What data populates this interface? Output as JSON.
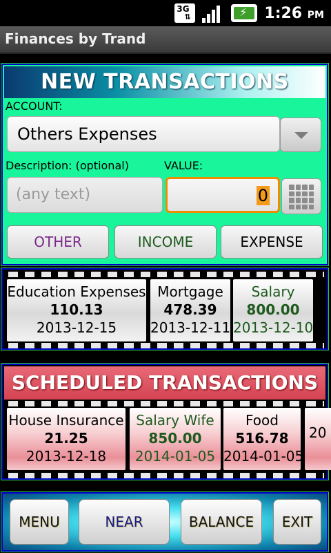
{
  "status": {
    "network": "3G",
    "time": "1:26",
    "ampm": "PM"
  },
  "app": {
    "title": "Finances by Trand"
  },
  "new_transactions": {
    "header": "NEW TRANSACTIONS",
    "account_label": "ACCOUNT:",
    "account_value": "Others Expenses",
    "description_label": "Description: (optional)",
    "description_placeholder": "(any text)",
    "value_label": "VALUE:",
    "value": "0",
    "buttons": {
      "other": "OTHER",
      "income": "INCOME",
      "expense": "EXPENSE"
    }
  },
  "recent": [
    {
      "name": "Education Expenses",
      "amount": "110.13",
      "date": "2013-12-15",
      "kind": "expense"
    },
    {
      "name": "Mortgage",
      "amount": "478.39",
      "date": "2013-12-11",
      "kind": "expense"
    },
    {
      "name": "Salary",
      "amount": "800.00",
      "date": "2013-12-10",
      "kind": "income"
    }
  ],
  "scheduled": {
    "header": "SCHEDULED TRANSACTIONS",
    "items": [
      {
        "name": "House Insurance",
        "amount": "21.25",
        "date": "2013-12-18",
        "kind": "expense"
      },
      {
        "name": "Salary Wife",
        "amount": "850.00",
        "date": "2014-01-05",
        "kind": "income"
      },
      {
        "name": "Food",
        "amount": "516.78",
        "date": "2014-01-05",
        "kind": "expense"
      },
      {
        "name": "",
        "amount": "",
        "date": "20",
        "kind": "expense"
      }
    ]
  },
  "bottom": {
    "menu": "MENU",
    "near": "NEAR",
    "balance": "BALANCE",
    "exit": "EXIT"
  },
  "colors": {
    "income": "#1e6a1e",
    "other": "#7a2a8a",
    "expense": "#000000",
    "accent": "#f08c00",
    "panel_green": "#19f59a",
    "border_blue": "#0000c8"
  }
}
